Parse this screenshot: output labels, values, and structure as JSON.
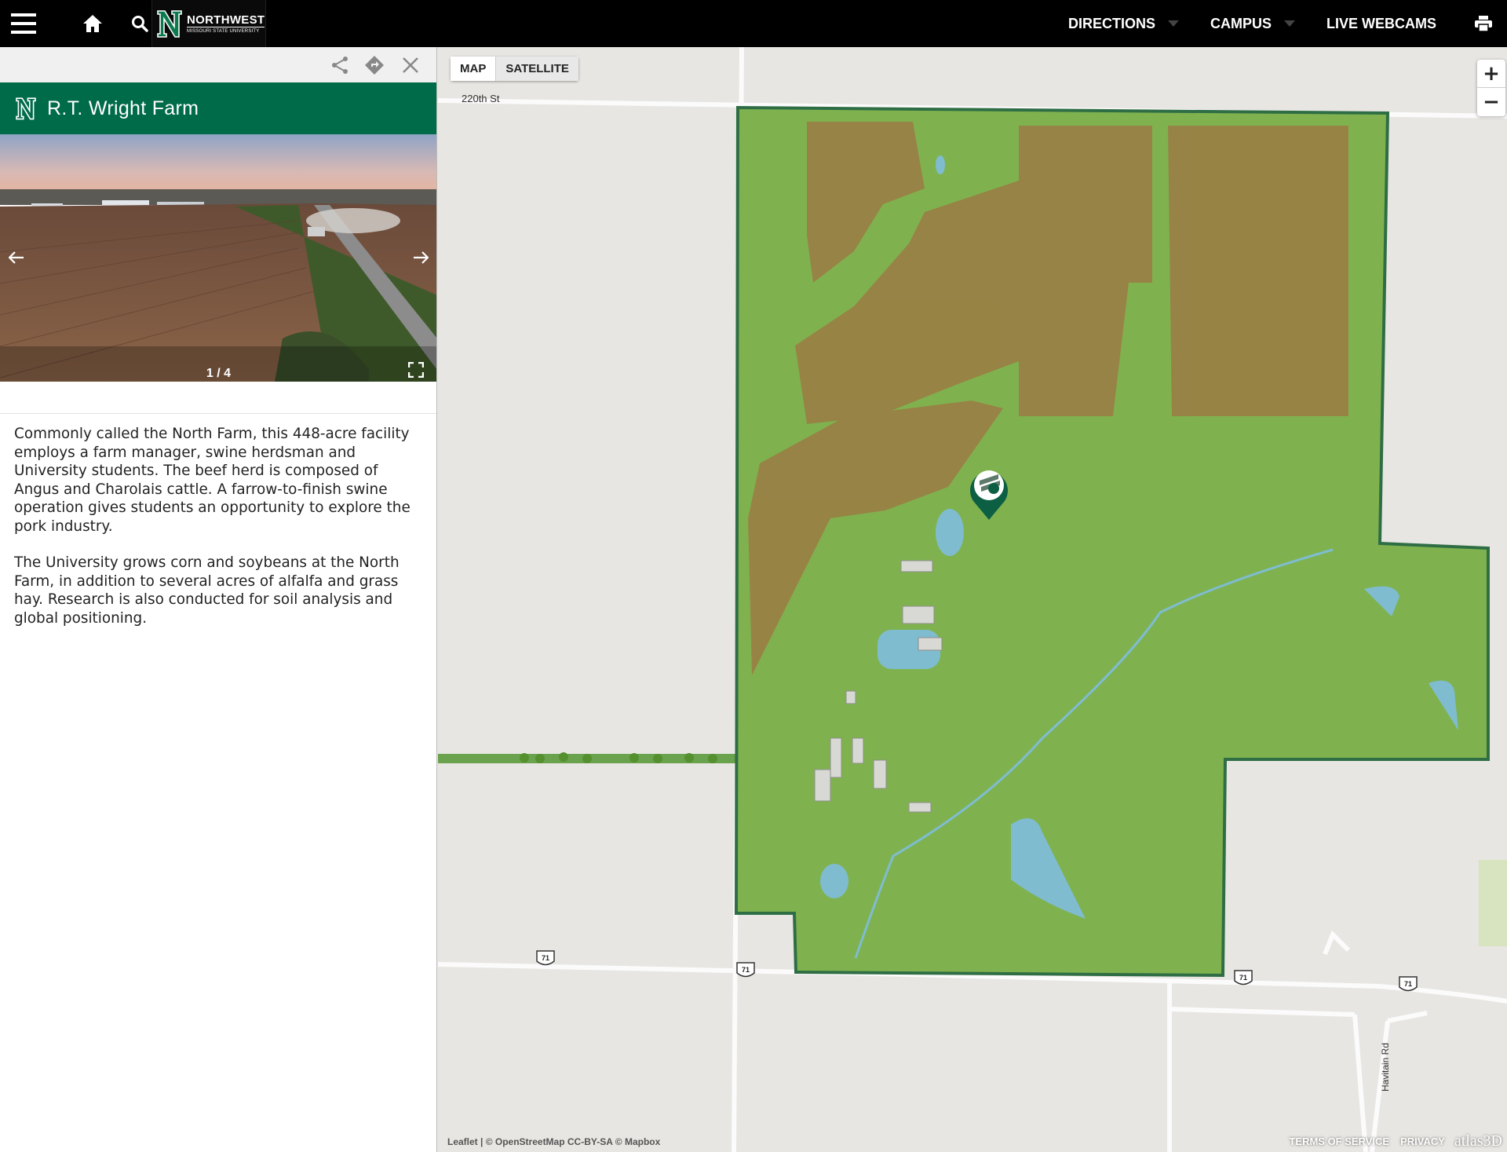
{
  "header": {
    "logo_main": "NORTHWEST",
    "logo_sub": "MISSOURI STATE UNIVERSITY",
    "nav": [
      {
        "label": "DIRECTIONS",
        "dropdown": true
      },
      {
        "label": "CAMPUS",
        "dropdown": true
      },
      {
        "label": "LIVE WEBCAMS",
        "dropdown": false
      }
    ],
    "icons": [
      "menu-icon",
      "home-icon",
      "search-icon",
      "print-icon"
    ]
  },
  "panel": {
    "title": "R.T. Wright Farm",
    "tools": [
      "share-icon",
      "directions-icon",
      "close-icon"
    ],
    "gallery": {
      "counter": "1 / 4",
      "current": 1,
      "total": 4
    },
    "description": [
      "Commonly called the North Farm, this 448-acre facility employs a farm manager, swine herdsman and University students. The beef herd is composed of Angus and Charolais cattle. A farrow-to-finish swine operation gives students an opportunity to explore the pork industry.",
      "The University grows corn and soybeans at the North Farm, in addition to several acres of alfalfa and grass hay. Research is also conducted for soil analysis and global positioning."
    ]
  },
  "map": {
    "toggle": {
      "map": "MAP",
      "satellite": "SATELLITE",
      "active": "MAP"
    },
    "zoom_in": "+",
    "zoom_out": "−",
    "road_220th": "220th St",
    "road_havitain": "Havitain Rd",
    "highway_number": "71",
    "attribution": "Leaflet | © OpenStreetMap CC-BY-SA © Mapbox",
    "terms": "TERMS OF SERVICE",
    "privacy": "PRIVACY",
    "brand": "atlas3D",
    "colors": {
      "farm_fill": "#7fb24f",
      "farm_border": "#2f6e45",
      "crop_field": "#9a7e44",
      "pond": "#7fbcd0",
      "brand_green": "#006b48"
    }
  }
}
